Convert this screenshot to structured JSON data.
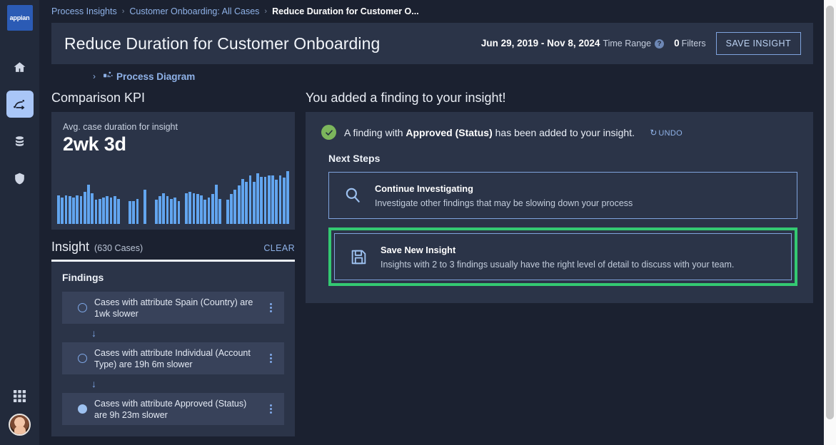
{
  "rail": {
    "logo_text": "appian",
    "items": [
      {
        "name": "home-icon",
        "label": "Home"
      },
      {
        "name": "process-icon",
        "label": "Process Insights",
        "active": true
      },
      {
        "name": "database-icon",
        "label": "Data"
      },
      {
        "name": "shield-icon",
        "label": "Security"
      },
      {
        "name": "apps-grid-icon",
        "label": "Apps"
      },
      {
        "name": "avatar",
        "label": "User profile"
      }
    ]
  },
  "breadcrumb": {
    "items": [
      "Process Insights",
      "Customer Onboarding: All Cases",
      "Reduce Duration for Customer O..."
    ],
    "separator": "›"
  },
  "header": {
    "title": "Reduce Duration for Customer Onboarding",
    "date_range": "Jun 29, 2019 - Nov 8, 2024",
    "time_range_label": "Time Range",
    "help_glyph": "?",
    "filters_count": "0",
    "filters_label": "Filters",
    "save_insight_label": "SAVE INSIGHT"
  },
  "process_diagram": {
    "chevron": "›",
    "label": "Process Diagram"
  },
  "left": {
    "comparison_kpi_title": "Comparison KPI",
    "kpi": {
      "label": "Avg. case duration for insight",
      "value": "2wk 3d"
    },
    "insight": {
      "title": "Insight",
      "count": "(630 Cases)",
      "clear_label": "CLEAR"
    },
    "findings_title": "Findings",
    "findings": [
      {
        "text": "Cases with attribute Spain (Country) are 1wk slower",
        "selected": false,
        "menu": "⋮"
      },
      {
        "text": "Cases with attribute Individual (Account Type) are 19h 6m slower",
        "selected": false,
        "menu": "⋮"
      },
      {
        "text": "Cases with attribute Approved (Status) are 9h 23m slower",
        "selected": true,
        "menu": "⋮"
      }
    ],
    "connector_glyph": "↓"
  },
  "main": {
    "heading": "You added a finding to your insight!",
    "toast": {
      "prefix": "A finding with ",
      "bold": "Approved (Status)",
      "suffix": " has been added to your insight.",
      "undo_label": "UNDO",
      "undo_glyph": "↺"
    },
    "next_steps_title": "Next Steps",
    "steps": [
      {
        "icon": "search-icon",
        "title": "Continue Investigating",
        "desc": "Investigate other findings that may be slowing down your process",
        "focused": false
      },
      {
        "icon": "save-icon",
        "title": "Save New Insight",
        "desc": "Insights with 2 to 3 findings usually have the right level of detail to discuss with your team.",
        "focused": true
      }
    ]
  },
  "chart_data": {
    "type": "bar",
    "title": "Avg. case duration for insight",
    "xlabel": "",
    "ylabel": "",
    "ylim": [
      0,
      100
    ],
    "categories": [],
    "values": [
      52,
      48,
      52,
      50,
      48,
      52,
      50,
      58,
      72,
      56,
      44,
      46,
      48,
      50,
      48,
      50,
      46,
      0,
      0,
      42,
      42,
      46,
      0,
      62,
      0,
      0,
      44,
      50,
      56,
      50,
      46,
      48,
      42,
      0,
      56,
      58,
      56,
      54,
      52,
      44,
      48,
      54,
      72,
      46,
      0,
      44,
      54,
      62,
      70,
      82,
      76,
      88,
      76,
      92,
      86,
      86,
      88,
      88,
      80,
      88,
      84,
      96
    ],
    "colors": {
      "bar": "#62a5ef"
    }
  },
  "colors": {
    "page_bg": "#1b2130",
    "panel_bg": "#2b3448",
    "rail_bg": "#222a3b",
    "accent_blue": "#8fb2e8",
    "logo_blue": "#2b5bb5",
    "success_green": "#7cb65c",
    "focus_green": "#34c972",
    "card_bg": "#38425a"
  }
}
